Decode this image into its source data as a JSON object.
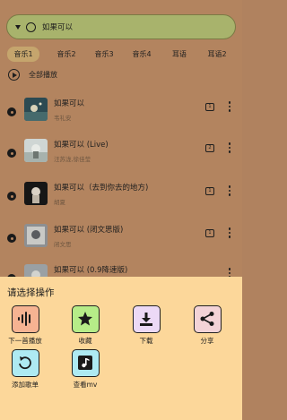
{
  "search": {
    "value": "如果可以"
  },
  "tabs": [
    "音乐1",
    "音乐2",
    "音乐3",
    "音乐4",
    "耳语",
    "耳语2"
  ],
  "play_all_label": "全部播放",
  "songs": [
    {
      "title": "如果可以",
      "artist": "韦礼安",
      "badge": "1"
    },
    {
      "title": "如果可以 (Live)",
      "artist": "汪苏泷,徐佳莹",
      "badge": "2"
    },
    {
      "title": "如果可以（去到你去的地方)",
      "artist": "胡夏",
      "badge": "1"
    },
    {
      "title": "如果可以 (闭文思版)",
      "artist": "闭文思",
      "badge": "1"
    },
    {
      "title": "如果可以 (0.9降速版)",
      "artist": "",
      "badge": ""
    }
  ],
  "sheet": {
    "heading": "请选择操作",
    "actions": [
      {
        "label": "下一首播放",
        "icon": "audio-wave-icon",
        "color": "#f6b392"
      },
      {
        "label": "收藏",
        "icon": "star-icon",
        "color": "#b6ec88"
      },
      {
        "label": "下载",
        "icon": "download-icon",
        "color": "#ecd9f6"
      },
      {
        "label": "分享",
        "icon": "share-icon",
        "color": "#f3d3d7"
      },
      {
        "label": "添加歌单",
        "icon": "playlist-add-icon",
        "color": "#aeeaf2"
      },
      {
        "label": "查看mv",
        "icon": "music-note-icon",
        "color": "#aeeaf2"
      }
    ]
  }
}
